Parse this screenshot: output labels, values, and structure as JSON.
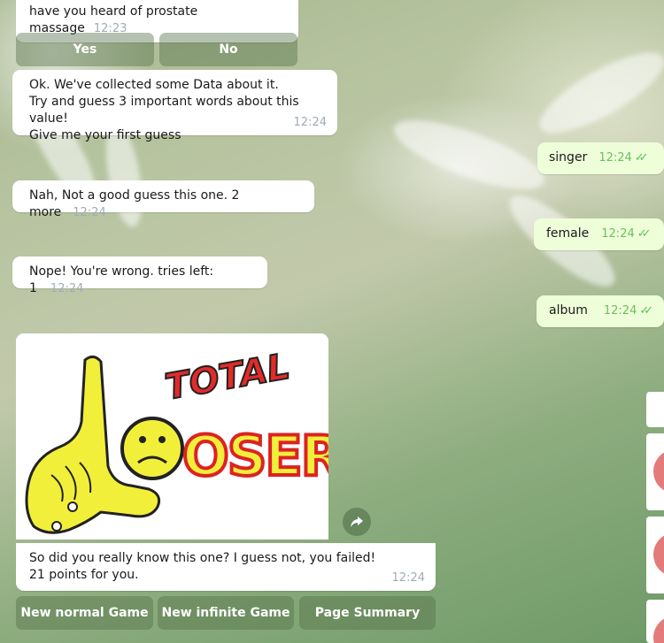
{
  "messages": {
    "m1": {
      "text": "have you heard of prostate massage",
      "time": "12:23"
    },
    "m2": {
      "text": "Ok. We've collected some Data about it.\nTry and guess 3 important words about this value!\nGive me your first guess",
      "time": "12:24"
    },
    "m3": {
      "text": "singer",
      "time": "12:24"
    },
    "m4": {
      "text": "Nah, Not a good guess this one. 2 more",
      "time": "12:24"
    },
    "m5": {
      "text": "female",
      "time": "12:24"
    },
    "m6": {
      "text": "Nope! You're wrong. tries left: 1",
      "time": "12:24"
    },
    "m7": {
      "text": "album",
      "time": "12:24"
    },
    "m8": {
      "text": "So did you really know this one? I guess not, you failed!\n21 points for you.",
      "time": "12:24"
    }
  },
  "keyboard1": {
    "yes": "Yes",
    "no": "No"
  },
  "keyboard2": {
    "normal": "New normal Game",
    "infinite": "New infinite Game",
    "summary": "Page Summary"
  },
  "photo": {
    "line1": "TOTAL",
    "line2": "OSER"
  },
  "read_ticks": "✓✓",
  "colors": {
    "incoming": "#ffffff",
    "outgoing": "#eefed9",
    "tick": "#5dc452"
  }
}
